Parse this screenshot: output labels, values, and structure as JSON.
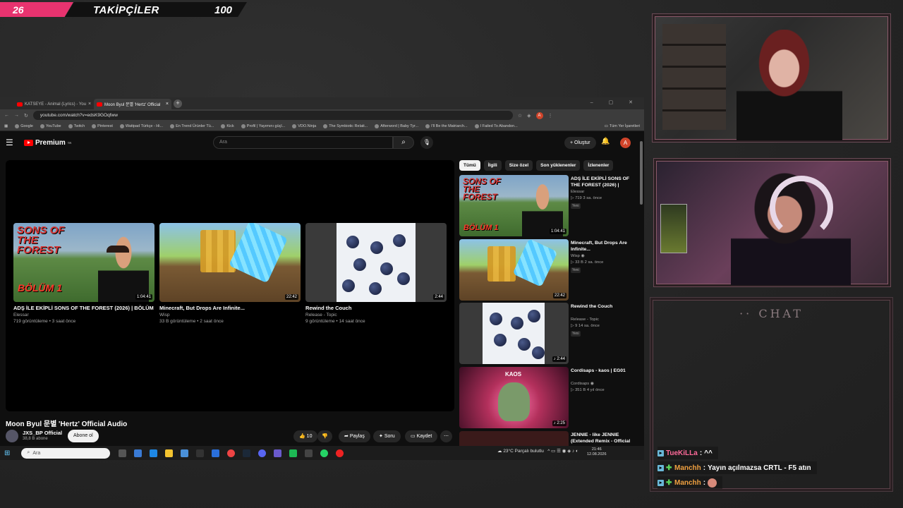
{
  "followers": {
    "count": "26",
    "label": "TAKİPÇİLER",
    "goal": "100"
  },
  "browser": {
    "tabs": [
      {
        "label": "KATSEYE - Animal (Lyrics) - You"
      },
      {
        "label": "Moon Byul 문별 'Hertz' Official"
      }
    ],
    "url": "youtube.com/watch?v=edsK9GOqfww",
    "bookmarks": [
      "Google",
      "YouTube",
      "Twitch",
      "Pinterest",
      "Wattpad Türkçe - Hi...",
      "En Trend Ürünler Tü...",
      "Kick",
      "Profil | Yayımını güçl...",
      "VDO.Ninja",
      "The Symbiotic Relati...",
      "Afterword | Baby Tyr...",
      "I'll Be the Matriarch...",
      "I Failed To Abandon..."
    ],
    "all_bookmarks": "Tüm Yer İşaretleri",
    "avatar_letter": "A"
  },
  "yt": {
    "logo": "Premium",
    "logo_sup": "TR",
    "search_placeholder": "Ara",
    "create": "Oluştur",
    "endcards": [
      {
        "title": "ADŞ İLE EKİPLİ SONS OF THE FOREST (2026) | BÖLÜM 1",
        "channel": "Elessar",
        "meta": "719 görüntüleme • 3 saat önce",
        "duration": "1:04:41"
      },
      {
        "title": "Minecraft, But Drops Are Infinite...",
        "channel": "Wisp",
        "meta": "33 B görüntüleme • 2 saat önce",
        "duration": "22:42"
      },
      {
        "title": "Rewind the Couch",
        "channel": "Release - Topic",
        "meta": "9 görüntüleme • 14 saat önce",
        "duration": "2:44"
      }
    ],
    "thumb_text": {
      "forest": "SONS OF THE FOREST",
      "bolum": "BÖLÜM 1"
    },
    "video_title": "Moon Byul 문별 'Hertz' Official Audio",
    "channel": "JXS_BP Official",
    "subs": "38,8 B abone",
    "subscribe": "Abone ol",
    "likes": "10",
    "share": "Paylaş",
    "ask": "Soru",
    "save": "Kaydet",
    "chips": [
      "Tümü",
      "İlgili",
      "Size özel",
      "Son yüklenenler",
      "İzlenenler"
    ],
    "sidebar": [
      {
        "title": "ADŞ İLE EKİPLİ SONS OF THE FOREST (2026) | BÖLÜM 1",
        "channel": "Elessar",
        "meta": "719  3 sa. önce",
        "badge": "Yeni",
        "duration": "1:04:41"
      },
      {
        "title": "Minecraft, But Drops Are Infinite...",
        "channel": "Wisp",
        "meta": "33 B  2 sa. önce",
        "badge": "Yeni",
        "duration": "22:42"
      },
      {
        "title": "Rewind the Couch",
        "channel": "Release - Topic",
        "meta": "9  14 sa. önce",
        "badge": "Yeni",
        "duration": "2:44"
      },
      {
        "title": "Cordisaps - kaos | EG01",
        "channel": "Cordisaps",
        "meta": "351 B  4 yıl önce",
        "badge": "",
        "duration": "2:25"
      },
      {
        "title": "JENNIE - like JENNIE (Extended Remix - Official",
        "channel": "",
        "meta": "",
        "badge": "",
        "duration": ""
      }
    ],
    "kaos_text": "KAOS"
  },
  "chat": {
    "title": "CHAT",
    "messages": [
      {
        "user": "TueKiLLa",
        "color": "#ff6a9a",
        "text": "^^"
      },
      {
        "user": "Manchh",
        "color": "#f0a040",
        "text": "Yayın açılmazsa CRTL - F5 atın"
      },
      {
        "user": "Manchh",
        "color": "#f0a040",
        "text": ""
      }
    ]
  },
  "taskbar": {
    "search": "Ara",
    "weather": "23°C",
    "weather_desc": "Parçalı bulutlu",
    "time": "21:46",
    "date": "12.08.2026"
  }
}
